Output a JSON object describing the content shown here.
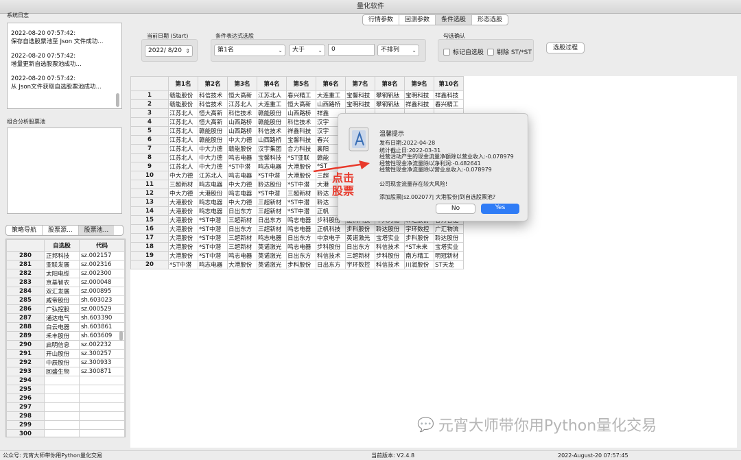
{
  "window_title": "量化软件",
  "left": {
    "log_label": "系统日志",
    "log_entries": [
      {
        "time": "2022-08-20 07:57:42:",
        "msg": "保存自选股票池至 Json 文件成功..."
      },
      {
        "time": "2022-08-20 07:57:42:",
        "msg": "增量更新自选股票池成功..."
      },
      {
        "time": "2022-08-20 07:57:42:",
        "msg": "从 Json文件获取自选股票池成功..."
      }
    ],
    "combo_label": "组合分析股票池",
    "tabs": [
      "策略导航",
      "股票源...",
      "股票池..."
    ],
    "stock_headers": [
      "自选股",
      "代码"
    ],
    "stock_rows": [
      {
        "n": "280",
        "name": "正邦科技",
        "code": "sz.002157"
      },
      {
        "n": "281",
        "name": "亚联发展",
        "code": "sz.002316"
      },
      {
        "n": "282",
        "name": "太阳电缆",
        "code": "sz.002300"
      },
      {
        "n": "283",
        "name": "京基智农",
        "code": "sz.000048"
      },
      {
        "n": "284",
        "name": "双汇发展",
        "code": "sz.000895"
      },
      {
        "n": "285",
        "name": "威帝股份",
        "code": "sh.603023"
      },
      {
        "n": "286",
        "name": "广弘控股",
        "code": "sz.000529"
      },
      {
        "n": "287",
        "name": "通达电气",
        "code": "sh.603390"
      },
      {
        "n": "288",
        "name": "白云电器",
        "code": "sh.603861"
      },
      {
        "n": "289",
        "name": "禾丰股份",
        "code": "sh.603609"
      },
      {
        "n": "290",
        "name": "启明信息",
        "code": "sz.002232"
      },
      {
        "n": "291",
        "name": "开山股份",
        "code": "sz.300257"
      },
      {
        "n": "292",
        "name": "中辰股份",
        "code": "sz.300933"
      },
      {
        "n": "293",
        "name": "回盛生物",
        "code": "sz.300871"
      },
      {
        "n": "294",
        "name": "",
        "code": ""
      },
      {
        "n": "295",
        "name": "",
        "code": ""
      },
      {
        "n": "296",
        "name": "",
        "code": ""
      },
      {
        "n": "297",
        "name": "",
        "code": ""
      },
      {
        "n": "298",
        "name": "",
        "code": ""
      },
      {
        "n": "299",
        "name": "",
        "code": ""
      },
      {
        "n": "300",
        "name": "",
        "code": ""
      }
    ]
  },
  "main_tabs": [
    "行情参数",
    "回测参数",
    "条件选股",
    "形态选股"
  ],
  "filters": {
    "date_label": "当前日期 (Start)",
    "date_value": "2022/  8/20",
    "cond_label": "条件表达式选股",
    "field_select": "第1名",
    "op_select": "大于",
    "value_input": "0",
    "sort_select": "不排列",
    "confirm_label": "勾选确认",
    "mark_label": "标记自选股",
    "exclude_label": "剔除 ST/*ST",
    "process_button": "选股过程"
  },
  "grid": {
    "headers": [
      "第1名",
      "第2名",
      "第3名",
      "第4名",
      "第5名",
      "第6名",
      "第7名",
      "第8名",
      "第9名",
      "第10名"
    ],
    "rows": [
      [
        "1",
        "赣能股份",
        "科信技术",
        "恒大高新",
        "江苏北人",
        "春兴精工",
        "大连重工",
        "宝馨科技",
        "攀钢钒钛",
        "宝明科技",
        "祥鑫科技"
      ],
      [
        "2",
        "赣能股份",
        "科信技术",
        "江苏北人",
        "大连重工",
        "恒大高新",
        "山西路桥",
        "宝明科技",
        "攀钢钒钛",
        "祥鑫科技",
        "春兴精工"
      ],
      [
        "3",
        "江苏北人",
        "恒大高新",
        "科信技术",
        "赣能股份",
        "山西路桥",
        "祥鑫",
        "",
        "",
        "",
        ""
      ],
      [
        "4",
        "江苏北人",
        "恒大高新",
        "山西路桥",
        "赣能股份",
        "科信技术",
        "汉宇",
        "",
        "",
        "",
        ""
      ],
      [
        "5",
        "江苏北人",
        "赣能股份",
        "山西路桥",
        "科信技术",
        "祥鑫科技",
        "汉宇",
        "",
        "",
        "",
        ""
      ],
      [
        "6",
        "江苏北人",
        "赣能股份",
        "中大力德",
        "山西路桥",
        "宝馨科技",
        "春兴",
        "",
        "",
        "",
        ""
      ],
      [
        "7",
        "江苏北人",
        "中大力德",
        "赣能股份",
        "汉宇集团",
        "合力科技",
        "襄阳",
        "",
        "",
        "",
        ""
      ],
      [
        "8",
        "江苏北人",
        "中大力德",
        "鸣志电器",
        "宝馨科技",
        "*ST亚联",
        "赣能",
        "",
        "",
        "",
        ""
      ],
      [
        "9",
        "江苏北人",
        "中大力德",
        "*ST中潜",
        "鸣志电器",
        "大港股份",
        "*ST",
        "",
        "",
        "",
        ""
      ],
      [
        "10",
        "中大力德",
        "江苏北人",
        "鸣志电器",
        "*ST中潜",
        "大港股份",
        "三超",
        "",
        "",
        "",
        ""
      ],
      [
        "11",
        "三超新材",
        "鸣志电器",
        "中大力德",
        "聆达股份",
        "*ST中潜",
        "大港",
        "",
        "",
        "",
        ""
      ],
      [
        "12",
        "中大力德",
        "大港股份",
        "鸣志电器",
        "*ST中潜",
        "三超新材",
        "聆达",
        "",
        "",
        "",
        ""
      ],
      [
        "13",
        "大港股份",
        "鸣志电器",
        "中大力德",
        "三超新材",
        "*ST中潜",
        "聆达",
        "",
        "",
        "",
        ""
      ],
      [
        "14",
        "大港股份",
        "鸣志电器",
        "日出东方",
        "三超新材",
        "*ST中潜",
        "正帆",
        "",
        "",
        "",
        ""
      ],
      [
        "15",
        "大港股份",
        "*ST中潜",
        "三超新材",
        "日出东方",
        "鸣志电器",
        "步科股份",
        "正帆科技",
        "中大力德",
        "聆达股份",
        "春秀智能"
      ],
      [
        "16",
        "大港股份",
        "*ST中潜",
        "日出东方",
        "三超新材",
        "鸣志电器",
        "正帆科技",
        "步科股份",
        "聆达股份",
        "宇环数控",
        "广汇物流"
      ],
      [
        "17",
        "大港股份",
        "*ST中潜",
        "三超新材",
        "鸣志电器",
        "日出东方",
        "中京电子",
        "英诺激光",
        "宝塔实业",
        "步科股份",
        "聆达股份"
      ],
      [
        "18",
        "大港股份",
        "*ST中潜",
        "三超新材",
        "英诺激光",
        "鸣志电器",
        "步科股份",
        "日出东方",
        "科信技术",
        "*ST未来",
        "宝塔实业"
      ],
      [
        "19",
        "大港股份",
        "*ST中潜",
        "鸣志电器",
        "英诺激光",
        "日出东方",
        "科信技术",
        "三超新材",
        "步科股份",
        "南方精工",
        "明冠新材"
      ],
      [
        "20",
        "*ST中潜",
        "鸣志电器",
        "大港股份",
        "英诺激光",
        "步科股份",
        "日出东方",
        "宇环数控",
        "科信技术",
        "川润股份",
        "ST天龙"
      ]
    ]
  },
  "dialog": {
    "title": "温馨提示",
    "lines": [
      "发布日期:2022-04-28",
      "统计截止日:2022-03-31",
      "经营活动产生的现金流量净额除以营业收入:-0.078979",
      "经营性现金净流量除以净利润:-0.482641",
      "经营性现金净流量除以营业总收入:-0.078979",
      "公司现金流量存在较大风险!",
      "添加股票[sz.002077| 大港股份]到自选股票池?"
    ],
    "no_label": "No",
    "yes_label": "Yes",
    "accent": "#2f7cf6"
  },
  "annotation": {
    "line1": "点击",
    "line2": "股票",
    "color": "#e8392b"
  },
  "status": {
    "left": "公众号: 元宵大师带你用Python量化交易",
    "version": "当前版本: V2.4.8",
    "time": "2022-August-20 07:57:45"
  },
  "watermark": "元宵大师带你用Python量化交易"
}
